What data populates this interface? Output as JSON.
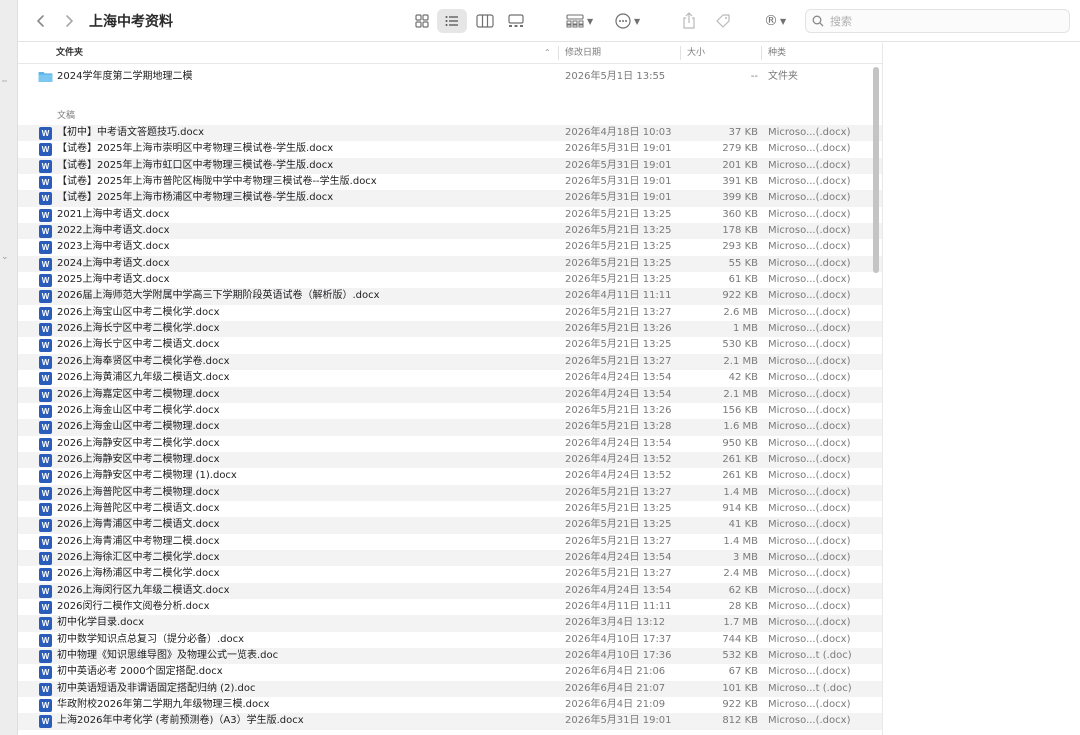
{
  "window": {
    "title": "上海中考资料"
  },
  "search": {
    "placeholder": "搜索"
  },
  "columns": {
    "name": "文件夹",
    "date": "修改日期",
    "size": "大小",
    "kind": "种类"
  },
  "folder": {
    "name": "2024学年度第二学期地理二模",
    "date": "2026年5月1日 13:55",
    "size": "--",
    "kind": "文件夹"
  },
  "section_label": "文稿",
  "colors": {
    "word_icon": "#2a5cba",
    "folder_icon": "#5bb3e8",
    "row_stripe": "#f3f3f4"
  },
  "files": [
    {
      "name": "【初中】中考语文答题技巧.docx",
      "date": "2026年4月18日 10:03",
      "size": "37 KB",
      "kind": "Microso...(.docx)"
    },
    {
      "name": "【试卷】2025年上海市崇明区中考物理三模试卷-学生版.docx",
      "date": "2026年5月31日 19:01",
      "size": "279 KB",
      "kind": "Microso...(.docx)"
    },
    {
      "name": "【试卷】2025年上海市虹口区中考物理三模试卷-学生版.docx",
      "date": "2026年5月31日 19:01",
      "size": "201 KB",
      "kind": "Microso...(.docx)"
    },
    {
      "name": "【试卷】2025年上海市普陀区梅陇中学中考物理三模试卷--学生版.docx",
      "date": "2026年5月31日 19:01",
      "size": "391 KB",
      "kind": "Microso...(.docx)"
    },
    {
      "name": "【试卷】2025年上海市杨浦区中考物理三模试卷-学生版.docx",
      "date": "2026年5月31日 19:01",
      "size": "399 KB",
      "kind": "Microso...(.docx)"
    },
    {
      "name": "2021上海中考语文.docx",
      "date": "2026年5月21日 13:25",
      "size": "360 KB",
      "kind": "Microso...(.docx)"
    },
    {
      "name": "2022上海中考语文.docx",
      "date": "2026年5月21日 13:25",
      "size": "178 KB",
      "kind": "Microso...(.docx)"
    },
    {
      "name": "2023上海中考语文.docx",
      "date": "2026年5月21日 13:25",
      "size": "293 KB",
      "kind": "Microso...(.docx)"
    },
    {
      "name": "2024上海中考语文.docx",
      "date": "2026年5月21日 13:25",
      "size": "55 KB",
      "kind": "Microso...(.docx)"
    },
    {
      "name": "2025上海中考语文.docx",
      "date": "2026年5月21日 13:25",
      "size": "61 KB",
      "kind": "Microso...(.docx)"
    },
    {
      "name": "2026届上海师范大学附属中学高三下学期阶段英语试卷（解析版）.docx",
      "date": "2026年4月11日 11:11",
      "size": "922 KB",
      "kind": "Microso...(.docx)"
    },
    {
      "name": "2026上海宝山区中考二模化学.docx",
      "date": "2026年5月21日 13:27",
      "size": "2.6 MB",
      "kind": "Microso...(.docx)"
    },
    {
      "name": "2026上海长宁区中考二模化学.docx",
      "date": "2026年5月21日 13:26",
      "size": "1 MB",
      "kind": "Microso...(.docx)"
    },
    {
      "name": "2026上海长宁区中考二模语文.docx",
      "date": "2026年5月21日 13:25",
      "size": "530 KB",
      "kind": "Microso...(.docx)"
    },
    {
      "name": "2026上海奉贤区中考二模化学卷.docx",
      "date": "2026年5月21日 13:27",
      "size": "2.1 MB",
      "kind": "Microso...(.docx)"
    },
    {
      "name": "2026上海黄浦区九年级二模语文.docx",
      "date": "2026年4月24日 13:54",
      "size": "42 KB",
      "kind": "Microso...(.docx)"
    },
    {
      "name": "2026上海嘉定区中考二模物理.docx",
      "date": "2026年4月24日 13:54",
      "size": "2.1 MB",
      "kind": "Microso...(.docx)"
    },
    {
      "name": "2026上海金山区中考二模化学.docx",
      "date": "2026年5月21日 13:26",
      "size": "156 KB",
      "kind": "Microso...(.docx)"
    },
    {
      "name": "2026上海金山区中考二模物理.docx",
      "date": "2026年5月21日 13:28",
      "size": "1.6 MB",
      "kind": "Microso...(.docx)"
    },
    {
      "name": "2026上海静安区中考二模化学.docx",
      "date": "2026年4月24日 13:54",
      "size": "950 KB",
      "kind": "Microso...(.docx)"
    },
    {
      "name": "2026上海静安区中考二模物理.docx",
      "date": "2026年4月24日 13:52",
      "size": "261 KB",
      "kind": "Microso...(.docx)"
    },
    {
      "name": "2026上海静安区中考二模物理 (1).docx",
      "date": "2026年4月24日 13:52",
      "size": "261 KB",
      "kind": "Microso...(.docx)"
    },
    {
      "name": "2026上海普陀区中考二模物理.docx",
      "date": "2026年5月21日 13:27",
      "size": "1.4 MB",
      "kind": "Microso...(.docx)"
    },
    {
      "name": "2026上海普陀区中考二模语文.docx",
      "date": "2026年5月21日 13:25",
      "size": "914 KB",
      "kind": "Microso...(.docx)"
    },
    {
      "name": "2026上海青浦区中考二模语文.docx",
      "date": "2026年5月21日 13:25",
      "size": "41 KB",
      "kind": "Microso...(.docx)"
    },
    {
      "name": "2026上海青浦区中考物理二模.docx",
      "date": "2026年5月21日 13:27",
      "size": "1.4 MB",
      "kind": "Microso...(.docx)"
    },
    {
      "name": "2026上海徐汇区中考二模化学.docx",
      "date": "2026年4月24日 13:54",
      "size": "3 MB",
      "kind": "Microso...(.docx)"
    },
    {
      "name": "2026上海杨浦区中考二模化学.docx",
      "date": "2026年5月21日 13:27",
      "size": "2.4 MB",
      "kind": "Microso...(.docx)"
    },
    {
      "name": "2026上海闵行区九年级二模语文.docx",
      "date": "2026年4月24日 13:54",
      "size": "62 KB",
      "kind": "Microso...(.docx)"
    },
    {
      "name": "2026闵行二模作文阅卷分析.docx",
      "date": "2026年4月11日 11:11",
      "size": "28 KB",
      "kind": "Microso...(.docx)"
    },
    {
      "name": "初中化学目录.docx",
      "date": "2026年3月4日 13:12",
      "size": "1.7 MB",
      "kind": "Microso...(.docx)"
    },
    {
      "name": "初中数学知识点总复习（提分必备）.docx",
      "date": "2026年4月10日 17:37",
      "size": "744 KB",
      "kind": "Microso...(.docx)"
    },
    {
      "name": "初中物理《知识思维导图》及物理公式一览表.doc",
      "date": "2026年4月10日 17:36",
      "size": "532 KB",
      "kind": "Microso...t (.doc)"
    },
    {
      "name": "初中英语必考 2000个固定搭配.docx",
      "date": "2026年6月4日 21:06",
      "size": "67 KB",
      "kind": "Microso...(.docx)"
    },
    {
      "name": "初中英语短语及非谓语固定搭配归纳 (2).doc",
      "date": "2026年6月4日 21:07",
      "size": "101 KB",
      "kind": "Microso...t (.doc)"
    },
    {
      "name": "华政附校2026年第二学期九年级物理三模.docx",
      "date": "2026年6月4日 21:09",
      "size": "922 KB",
      "kind": "Microso...(.docx)"
    },
    {
      "name": "上海2026年中考化学 (考前预测卷)（A3）学生版.docx",
      "date": "2026年5月31日 19:01",
      "size": "812 KB",
      "kind": "Microso...(.docx)"
    }
  ]
}
